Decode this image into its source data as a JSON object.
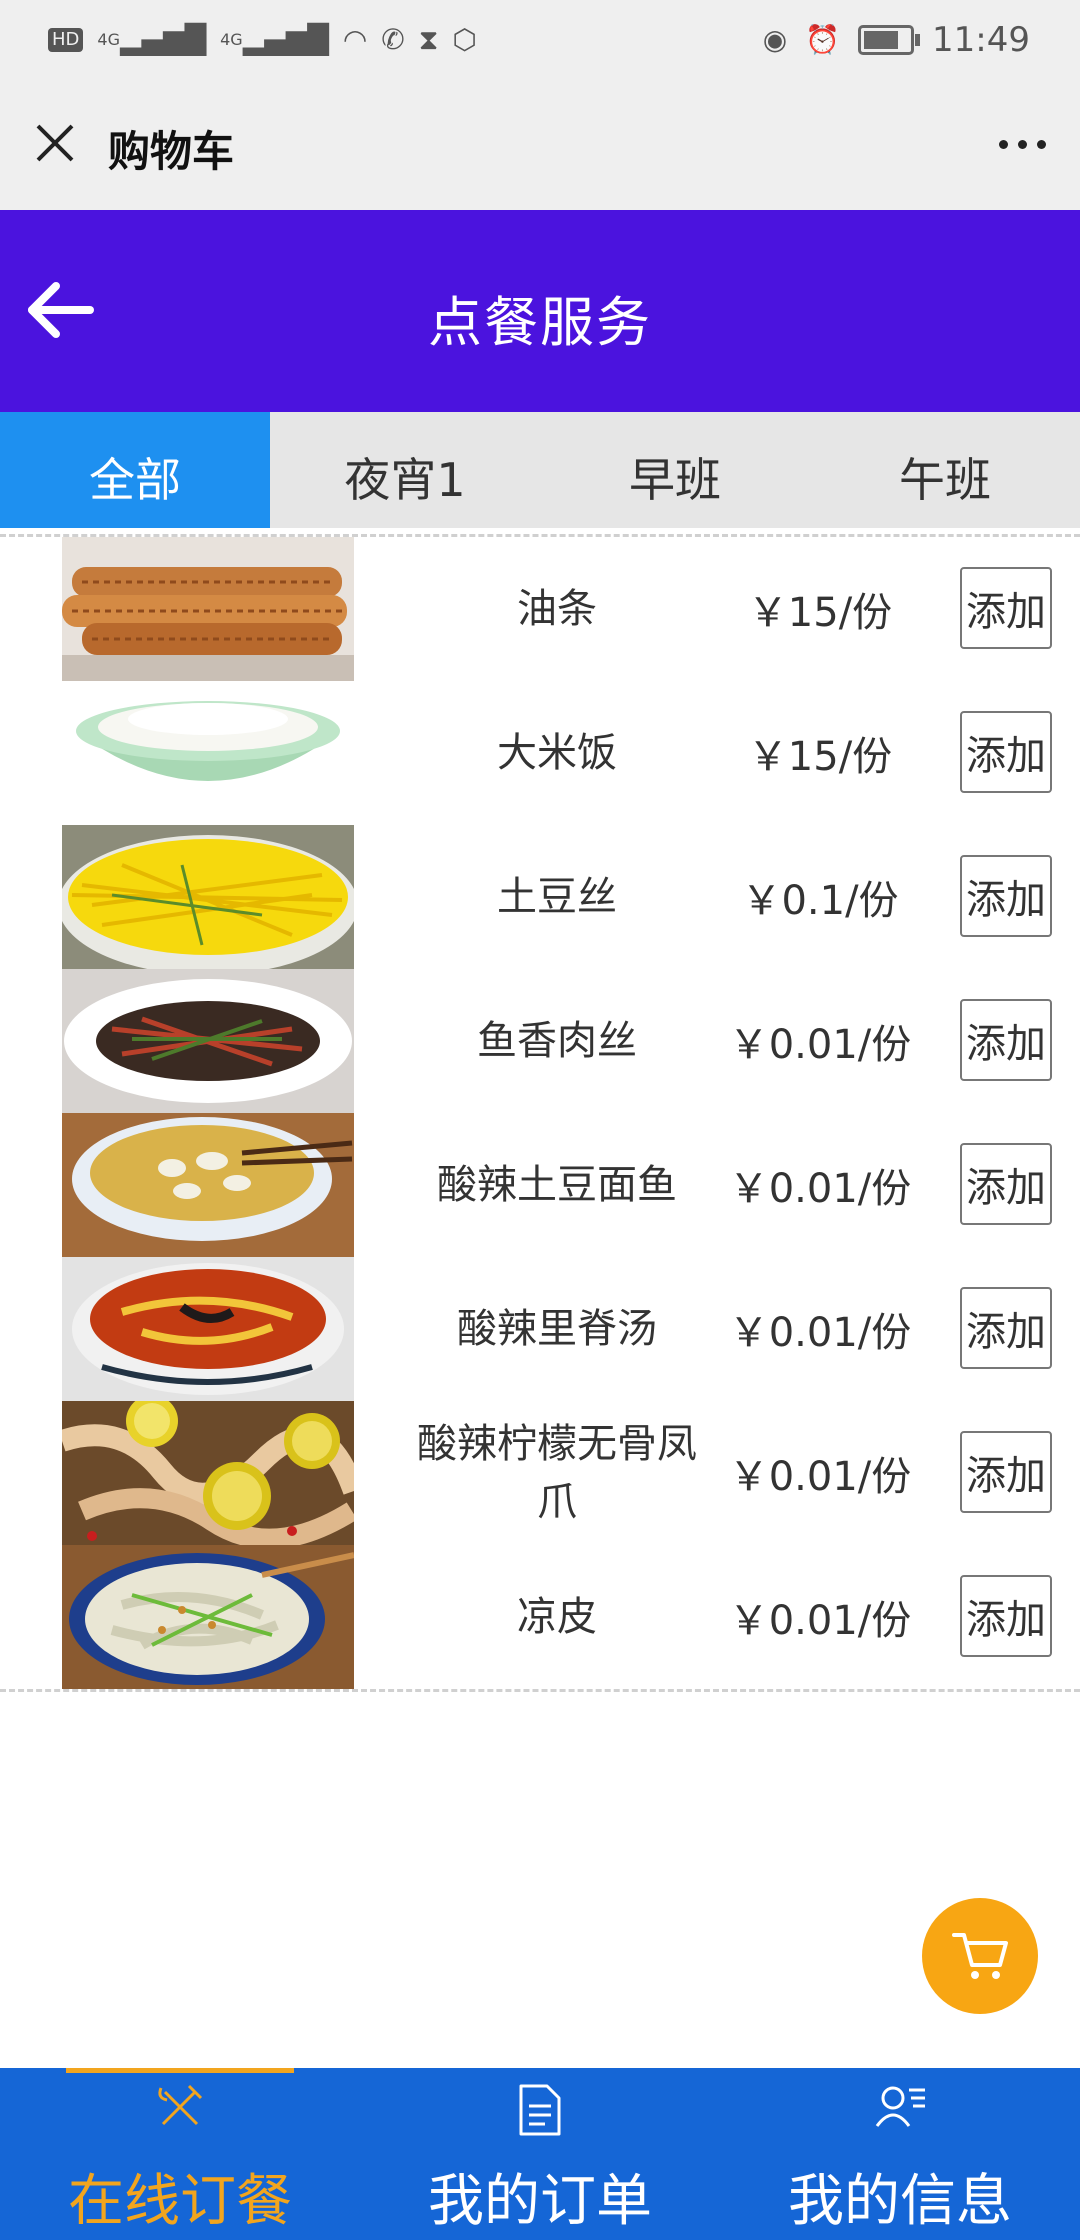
{
  "status_bar": {
    "hd_label": "HD",
    "network_1": "4G",
    "network_2": "4G",
    "time": "11:49"
  },
  "titlebar": {
    "title": "购物车"
  },
  "header": {
    "title": "点餐服务"
  },
  "tabs": [
    {
      "label": "全部",
      "active": true
    },
    {
      "label": "夜宵1",
      "active": false
    },
    {
      "label": "早班",
      "active": false
    },
    {
      "label": "午班",
      "active": false
    }
  ],
  "menu": [
    {
      "name": "油条",
      "price": "￥15/份",
      "add_label": "添加",
      "image": "fried-dough-stick"
    },
    {
      "name": "大米饭",
      "price": "￥15/份",
      "add_label": "添加",
      "image": "rice-bowl"
    },
    {
      "name": "土豆丝",
      "price": "￥0.1/份",
      "add_label": "添加",
      "image": "shredded-potato"
    },
    {
      "name": "鱼香肉丝",
      "price": "￥0.01/份",
      "add_label": "添加",
      "image": "shredded-pork"
    },
    {
      "name": "酸辣土豆面鱼",
      "price": "￥0.01/份",
      "add_label": "添加",
      "image": "potato-noodle"
    },
    {
      "name": "酸辣里脊汤",
      "price": "￥0.01/份",
      "add_label": "添加",
      "image": "tenderloin-soup"
    },
    {
      "name": "酸辣柠檬无骨凤爪",
      "price": "￥0.01/份",
      "add_label": "添加",
      "image": "lemon-chicken-feet"
    },
    {
      "name": "凉皮",
      "price": "￥0.01/份",
      "add_label": "添加",
      "image": "liangpi"
    }
  ],
  "bottom_nav": [
    {
      "label": "在线订餐",
      "icon": "fork-knife-icon",
      "active": true
    },
    {
      "label": "我的订单",
      "icon": "document-icon",
      "active": false
    },
    {
      "label": "我的信息",
      "icon": "user-list-icon",
      "active": false
    }
  ],
  "colors": {
    "header": "#4b13de",
    "tab_active": "#1e90f0",
    "bottom_nav": "#1566d6",
    "accent": "#f2a51e",
    "cart_fab": "#f8a613"
  }
}
